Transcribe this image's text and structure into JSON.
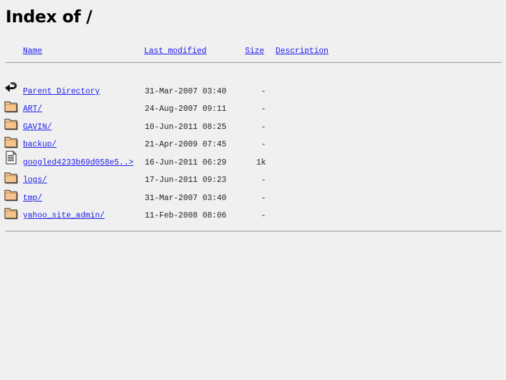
{
  "page": {
    "title": "Index of /"
  },
  "columns": {
    "name": "Name",
    "last_modified": "Last modified",
    "size": "Size",
    "description": "Description"
  },
  "entries": [
    {
      "icon": "back-icon",
      "name": "Parent Directory",
      "modified": "31-Mar-2007 03:40",
      "size": "-",
      "description": ""
    },
    {
      "icon": "folder-icon",
      "name": "ART/",
      "modified": "24-Aug-2007 09:11",
      "size": "-",
      "description": ""
    },
    {
      "icon": "folder-icon",
      "name": "GAVIN/",
      "modified": "10-Jun-2011 08:25",
      "size": "-",
      "description": ""
    },
    {
      "icon": "folder-icon",
      "name": "backup/",
      "modified": "21-Apr-2009 07:45",
      "size": "-",
      "description": ""
    },
    {
      "icon": "text-file-icon",
      "name": "googled4233b69d058e5..>",
      "modified": "16-Jun-2011 06:29",
      "size": "1k",
      "description": ""
    },
    {
      "icon": "folder-icon",
      "name": "logs/",
      "modified": "17-Jun-2011 09:23",
      "size": "-",
      "description": ""
    },
    {
      "icon": "folder-icon",
      "name": "tmp/",
      "modified": "31-Mar-2007 03:40",
      "size": "-",
      "description": ""
    },
    {
      "icon": "folder-icon",
      "name": "yahoo_site_admin/",
      "modified": "11-Feb-2008 08:06",
      "size": "-",
      "description": ""
    }
  ]
}
